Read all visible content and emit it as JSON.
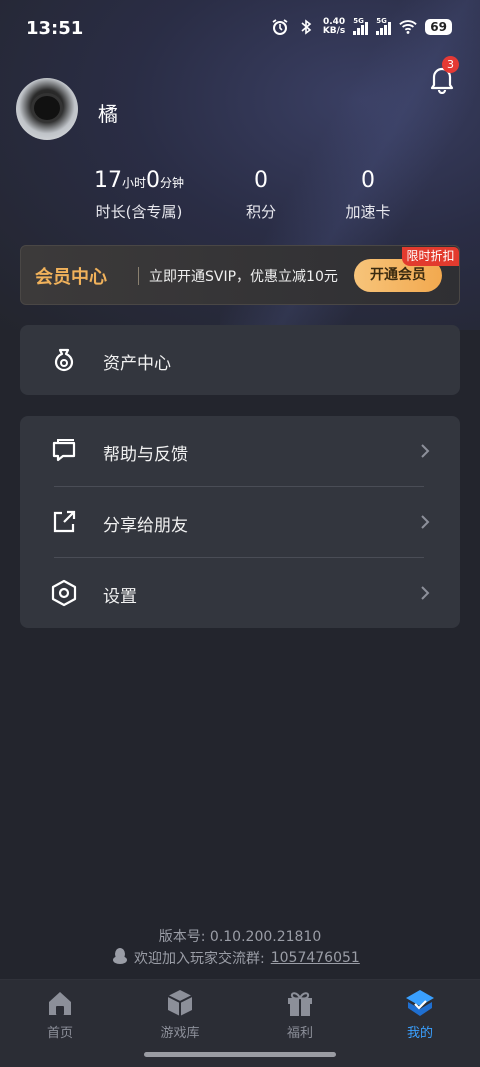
{
  "status_bar": {
    "time": "13:51",
    "net_speed": "0.40",
    "net_unit": "KB/s",
    "sig1_tag": "5G",
    "sig2_tag": "5G",
    "battery": "69"
  },
  "notifications": {
    "count": "3"
  },
  "profile": {
    "name": "橘"
  },
  "stats": {
    "duration_hours": "17",
    "hours_unit": "小时",
    "duration_minutes": "0",
    "minutes_unit": "分钟",
    "duration_label": "时长(含专属)",
    "points_value": "0",
    "points_label": "积分",
    "boost_value": "0",
    "boost_label": "加速卡"
  },
  "vip": {
    "title": "会员中心",
    "description": "立即开通SVIP，优惠立减10元",
    "button": "开通会员",
    "tag": "限时折扣"
  },
  "menu": {
    "assets": "资产中心",
    "help": "帮助与反馈",
    "share": "分享给朋友",
    "settings": "设置"
  },
  "footer": {
    "version": "版本号: 0.10.200.21810",
    "group_label": "欢迎加入玩家交流群:",
    "group_number": "1057476051"
  },
  "nav": {
    "home": "首页",
    "games": "游戏库",
    "welfare": "福利",
    "mine": "我的"
  },
  "colors": {
    "accent": "#3aa0ff",
    "vip_gold": "#f1b25b",
    "badge_red": "#e53935"
  }
}
